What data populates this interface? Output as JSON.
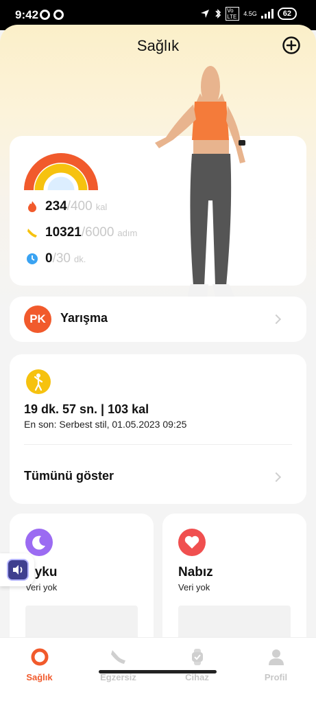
{
  "status_bar": {
    "time": "9:42",
    "network": "4.5G",
    "volte": "Vo LTE",
    "battery": "62"
  },
  "header": {
    "title": "Sağlık"
  },
  "activity": {
    "ring_colors": {
      "calories": "#f15a2c",
      "steps": "#f6c20f",
      "duration": "#9fd0f5"
    },
    "calories": {
      "value": "234",
      "goal": "/400",
      "unit": "kal"
    },
    "steps": {
      "value": "10321",
      "goal": "/6000",
      "unit": "adım"
    },
    "duration": {
      "value": "0",
      "goal": "/30",
      "unit": "dk."
    }
  },
  "contest": {
    "badge": "PK",
    "label": "Yarışma"
  },
  "workout": {
    "summary": "19 dk. 57 sn. | 103 kal",
    "last": "En son: Serbest stil, 01.05.2023 09:25",
    "show_all": "Tümünü göster"
  },
  "sleep": {
    "title": "Uyku",
    "subtitle": "Veri yok",
    "color": "#9b6bf2"
  },
  "pulse": {
    "title": "Nabız",
    "subtitle": "Veri yok",
    "color": "#f04f4f"
  },
  "nav": {
    "items": [
      {
        "label": "Sağlık",
        "icon": "health-ring-icon",
        "active": true
      },
      {
        "label": "Egzersiz",
        "icon": "shoe-icon",
        "active": false
      },
      {
        "label": "Cihaz",
        "icon": "watch-icon",
        "active": false
      },
      {
        "label": "Profil",
        "icon": "person-icon",
        "active": false
      }
    ]
  }
}
